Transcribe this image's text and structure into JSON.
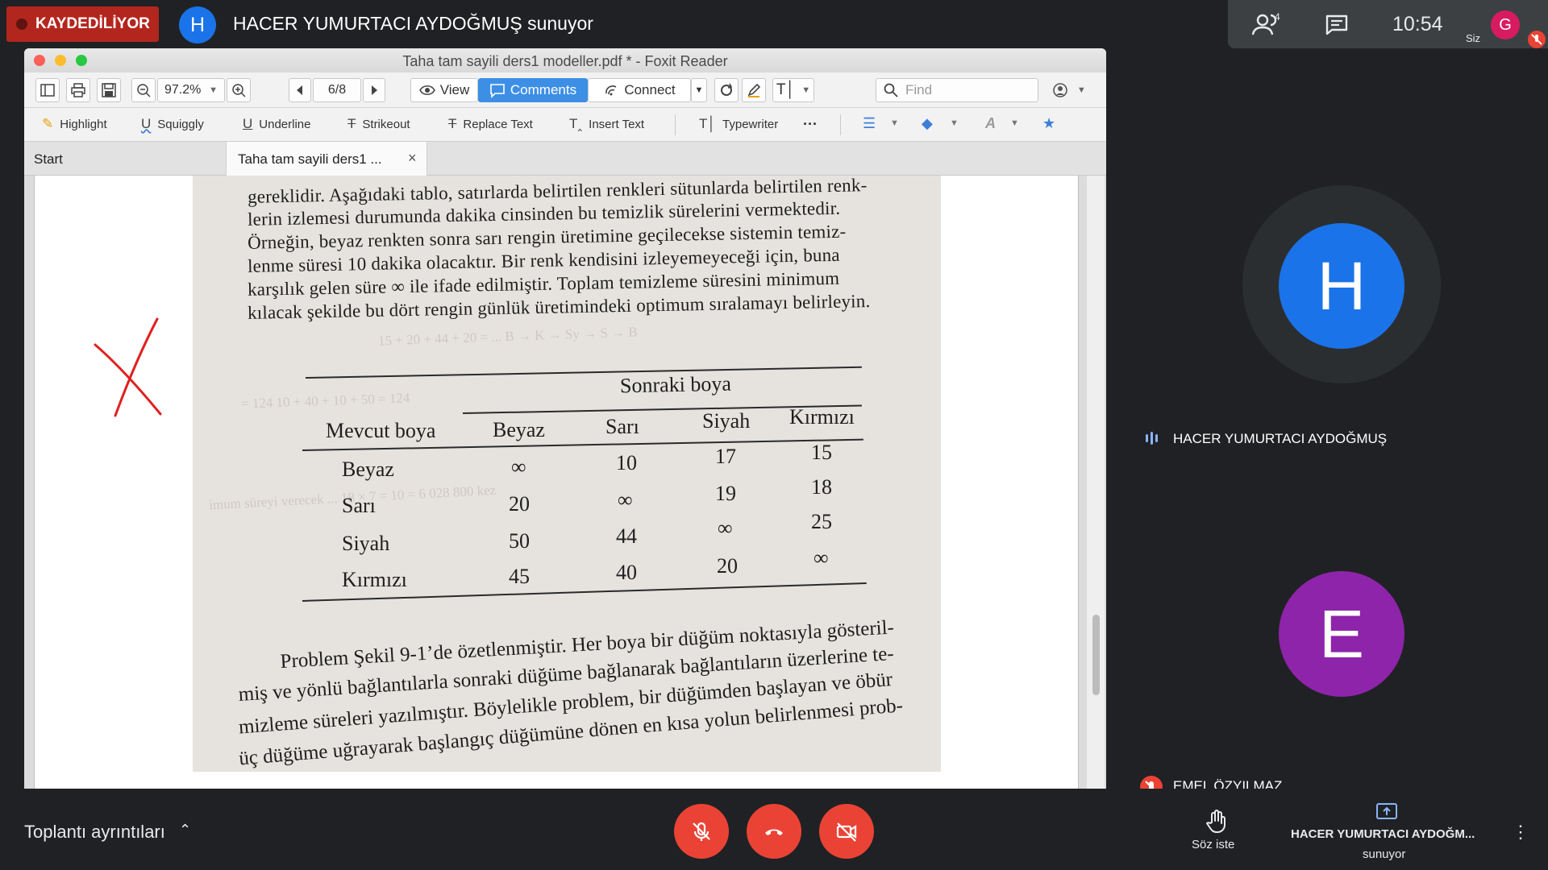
{
  "meet": {
    "recording_label": "KAYDEDİLİYOR",
    "presenter_initial": "H",
    "presenter_title": "HACER YUMURTACI AYDOĞMUŞ sunuyor",
    "people_count": "4",
    "clock": "10:54",
    "self_initial": "G",
    "self_label": "Siz",
    "participants": [
      {
        "initial": "H",
        "name": "HACER YUMURTACI AYDOĞMUŞ",
        "color": "#1a73e8"
      },
      {
        "initial": "E",
        "name": "EMEL ÖZYILMAZ",
        "color": "#8e24aa"
      }
    ],
    "meeting_details": "Toplantı ayrıntıları",
    "raise_hand": "Söz iste",
    "presenting_name": "HACER YUMURTACI AYDOĞM...",
    "presenting_sub": "sunuyor",
    "colors": {
      "bg": "#202124",
      "red": "#ea4335",
      "accent": "#1a73e8"
    }
  },
  "foxit": {
    "window_title": "Taha tam sayili ders1 modeller.pdf * - Foxit Reader",
    "zoom": "97.2%",
    "page_indicator": "6/8",
    "view_label": "View",
    "comments_label": "Comments",
    "connect_label": "Connect",
    "find_placeholder": "Find",
    "tools": [
      "Highlight",
      "Squiggly",
      "Underline",
      "Strikeout",
      "Replace Text",
      "Insert Text",
      "Typewriter"
    ],
    "tab_start": "Start",
    "tab_doc": "Taha tam sayili ders1 ...",
    "tab_close": "×"
  },
  "document": {
    "para1": [
      "gereklidir. Aşağıdaki tablo, satırlarda belirtilen renkleri sütunlarda belirtilen renk-",
      "lerin izlemesi durumunda dakika cinsinden bu temizlik sürelerini vermektedir.",
      "Örneğin, beyaz renkten sonra sarı rengin üretimine geçilecekse sistemin temiz-",
      "lenme süresi 10 dakika olacaktır. Bir renk kendisini izleyemeyeceği için, buna",
      "karşılık gelen süre ∞ ile ifade edilmiştir. Toplam temizleme süresini minimum",
      "kılacak şekilde bu dört rengin günlük üretimindeki optimum sıralamayı belirleyin."
    ],
    "table": {
      "group_header": "Sonraki boya",
      "row_header": "Mevcut boya",
      "columns": [
        "Beyaz",
        "Sarı",
        "Siyah",
        "Kırmızı"
      ],
      "rows": [
        {
          "name": "Beyaz",
          "values": [
            "∞",
            "10",
            "17",
            "15"
          ]
        },
        {
          "name": "Sarı",
          "values": [
            "20",
            "∞",
            "19",
            "18"
          ]
        },
        {
          "name": "Siyah",
          "values": [
            "50",
            "44",
            "∞",
            "25"
          ]
        },
        {
          "name": "Kırmızı",
          "values": [
            "45",
            "40",
            "20",
            "∞"
          ]
        }
      ]
    },
    "para2": [
      "Problem Şekil 9-1’de özetlenmiştir. Her boya bir düğüm noktasıyla gösteril-",
      "miş ve yönlü bağlantılarla sonraki düğüme bağlanarak bağlantıların üzerlerine te-",
      "mizleme süreleri yazılmıştır. Böylelikle problem, bir düğümden başlayan ve öbür",
      "üç düğüme uğrayarak başlangıç düğümüne dönen en kısa yolun belirlenmesi prob-"
    ],
    "annotation_color": "#e02020"
  }
}
